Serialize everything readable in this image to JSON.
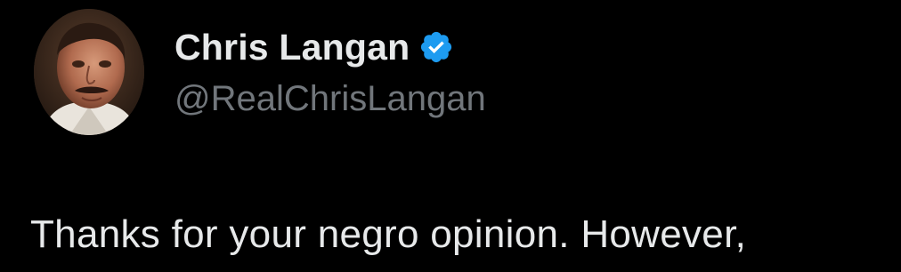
{
  "author": {
    "display_name": "Chris Langan",
    "handle": "@RealChrisLangan",
    "verified": true,
    "verified_icon": "verified-badge-icon",
    "avatar": "profile-photo"
  },
  "tweet": {
    "text": "Thanks for your negro opinion. However,"
  },
  "colors": {
    "background": "#000000",
    "name": "#e7e9ea",
    "handle": "#71767b",
    "verified": "#1d9bf0",
    "text": "#e7e9ea"
  }
}
